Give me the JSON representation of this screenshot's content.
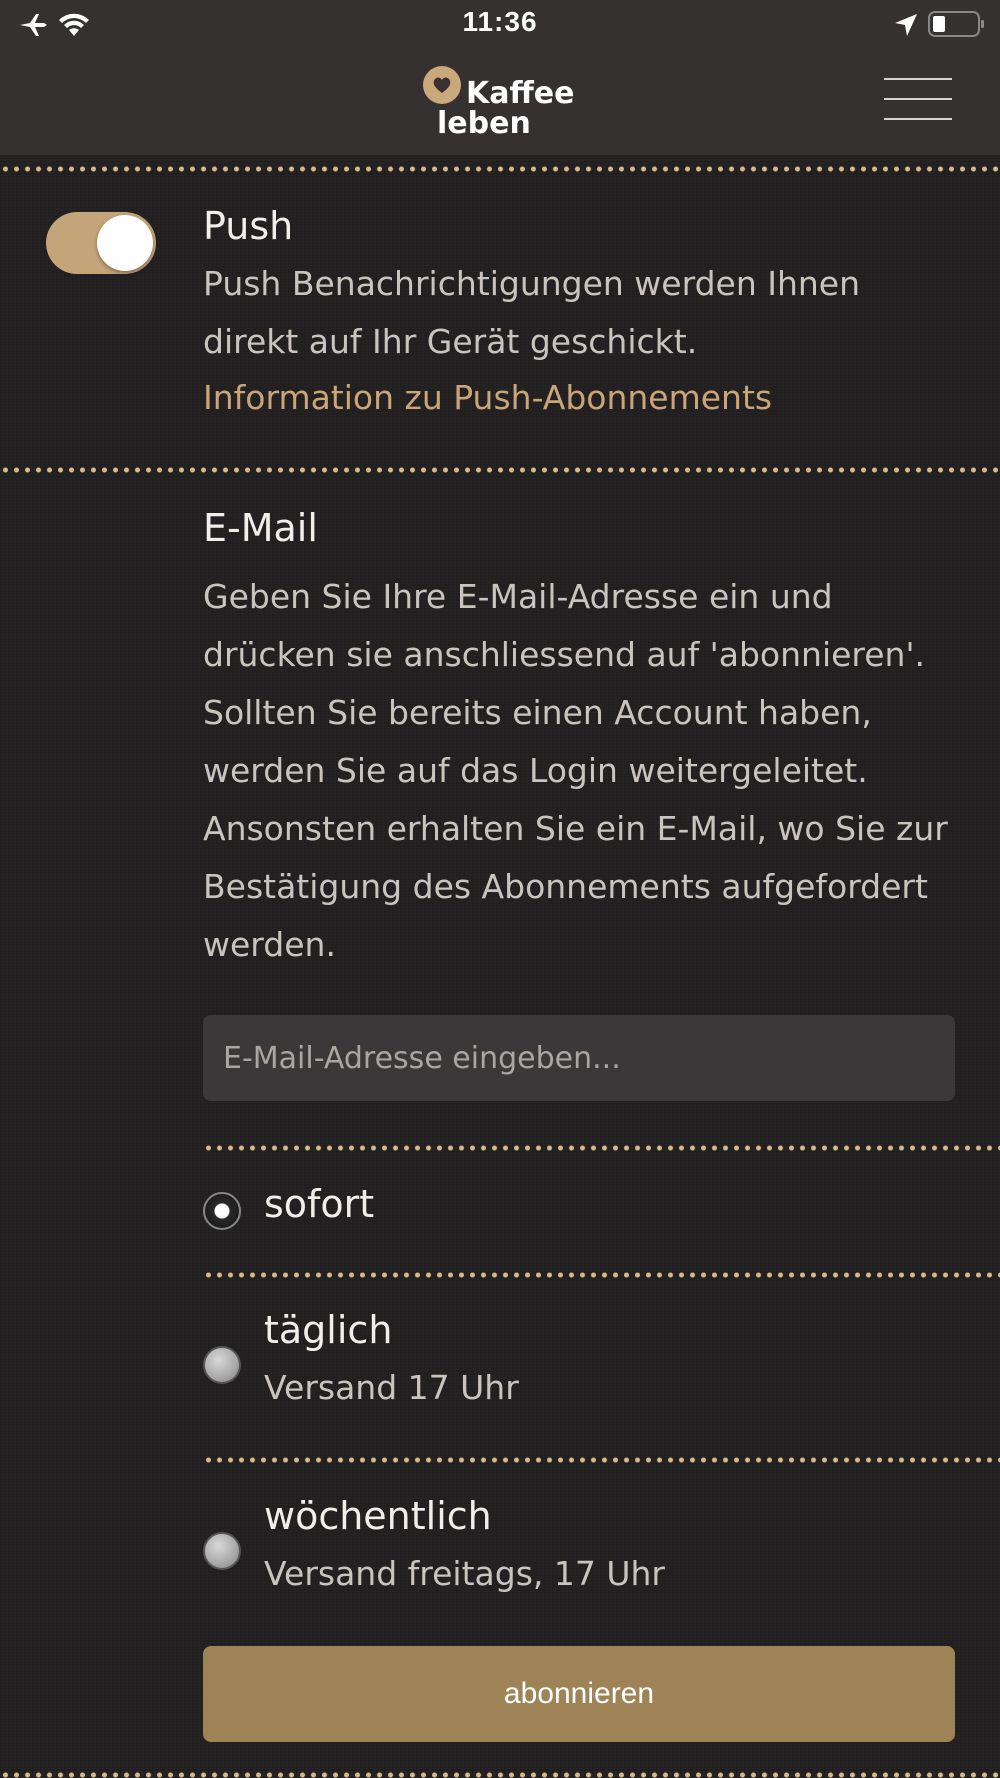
{
  "statusbar": {
    "time": "11:36"
  },
  "header": {
    "logo_line1": "Kaffee",
    "logo_line2": "leben"
  },
  "push": {
    "enabled": true,
    "title": "Push",
    "description": "Push Benachrichtigungen werden Ihnen direkt auf Ihr Gerät geschickt.",
    "link": "Information zu Push-Abonnements"
  },
  "email": {
    "title": "E-Mail",
    "description": "Geben Sie Ihre E-Mail-Adresse ein und drücken sie anschliessend auf 'abonnieren'. Sollten Sie bereits einen Account haben, werden Sie auf das Login weitergeleitet. Ansonsten erhalten Sie ein E-Mail, wo Sie zur Bestätigung des Abonnements aufgefordert werden.",
    "input_placeholder": "E-Mail-Adresse eingeben...",
    "input_value": ""
  },
  "frequency": {
    "selected": "sofort",
    "options": [
      {
        "label": "sofort",
        "sub": ""
      },
      {
        "label": "täglich",
        "sub": "Versand 17 Uhr"
      },
      {
        "label": "wöchentlich",
        "sub": "Versand freitags, 17 Uhr"
      }
    ]
  },
  "submit_label": "abonnieren",
  "colors": {
    "accent": "#caa577",
    "button": "#9e8357",
    "background": "#222020",
    "header": "#353131"
  }
}
